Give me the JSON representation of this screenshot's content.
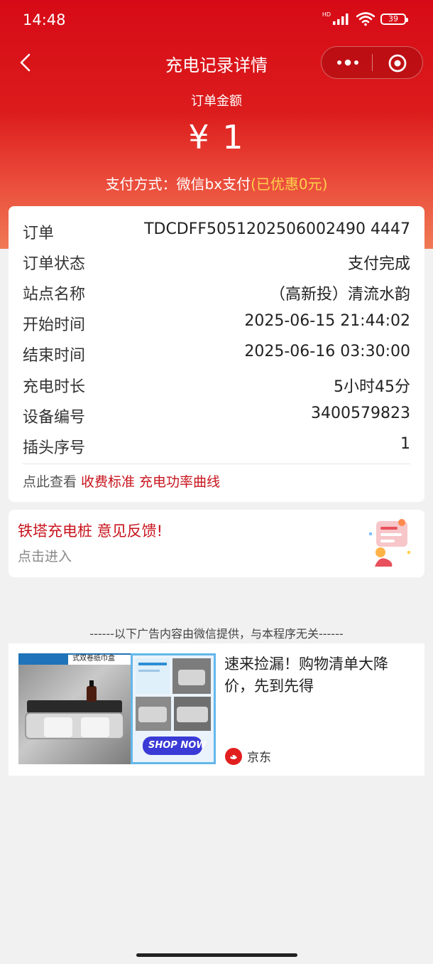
{
  "status_bar": {
    "time": "14:48",
    "network_badge": "HD",
    "battery_level": "39"
  },
  "nav": {
    "title": "充电记录详情"
  },
  "summary": {
    "amount_label": "订单金额",
    "amount": "¥ 1",
    "payment_prefix": "支付方式：微信bx支付",
    "payment_discount": "(已优惠0元)"
  },
  "details": [
    {
      "key": "订单",
      "value": "TDCDFF5051202506002490 4447"
    },
    {
      "key": "订单状态",
      "value": "支付完成"
    },
    {
      "key": "站点名称",
      "value": "（高新投）清流水韵"
    },
    {
      "key": "开始时间",
      "value": "2025-06-15 21:44:02"
    },
    {
      "key": "结束时间",
      "value": "2025-06-16 03:30:00"
    },
    {
      "key": "充电时长",
      "value": "5小时45分"
    },
    {
      "key": "设备编号",
      "value": "3400579823"
    },
    {
      "key": "插头序号",
      "value": "1"
    }
  ],
  "links": {
    "prefix": "点此查看",
    "fee_standard": "收费标准",
    "power_curve": "充电功率曲线"
  },
  "feedback": {
    "title": "铁塔充电桩 意见反馈!",
    "subtitle": "点击进入"
  },
  "ad": {
    "notice": "------以下广告内容由微信提供，与本程序无关------",
    "title": "速来捡漏！购物清单大降价，先到先得",
    "brand": "京东",
    "image_banner": "式双卷纸巾盒",
    "shop_now": "SHOP NOW"
  },
  "colors": {
    "brand_red": "#d60a16",
    "link_red": "#c8141d",
    "discount_yellow": "#ffd24a"
  }
}
